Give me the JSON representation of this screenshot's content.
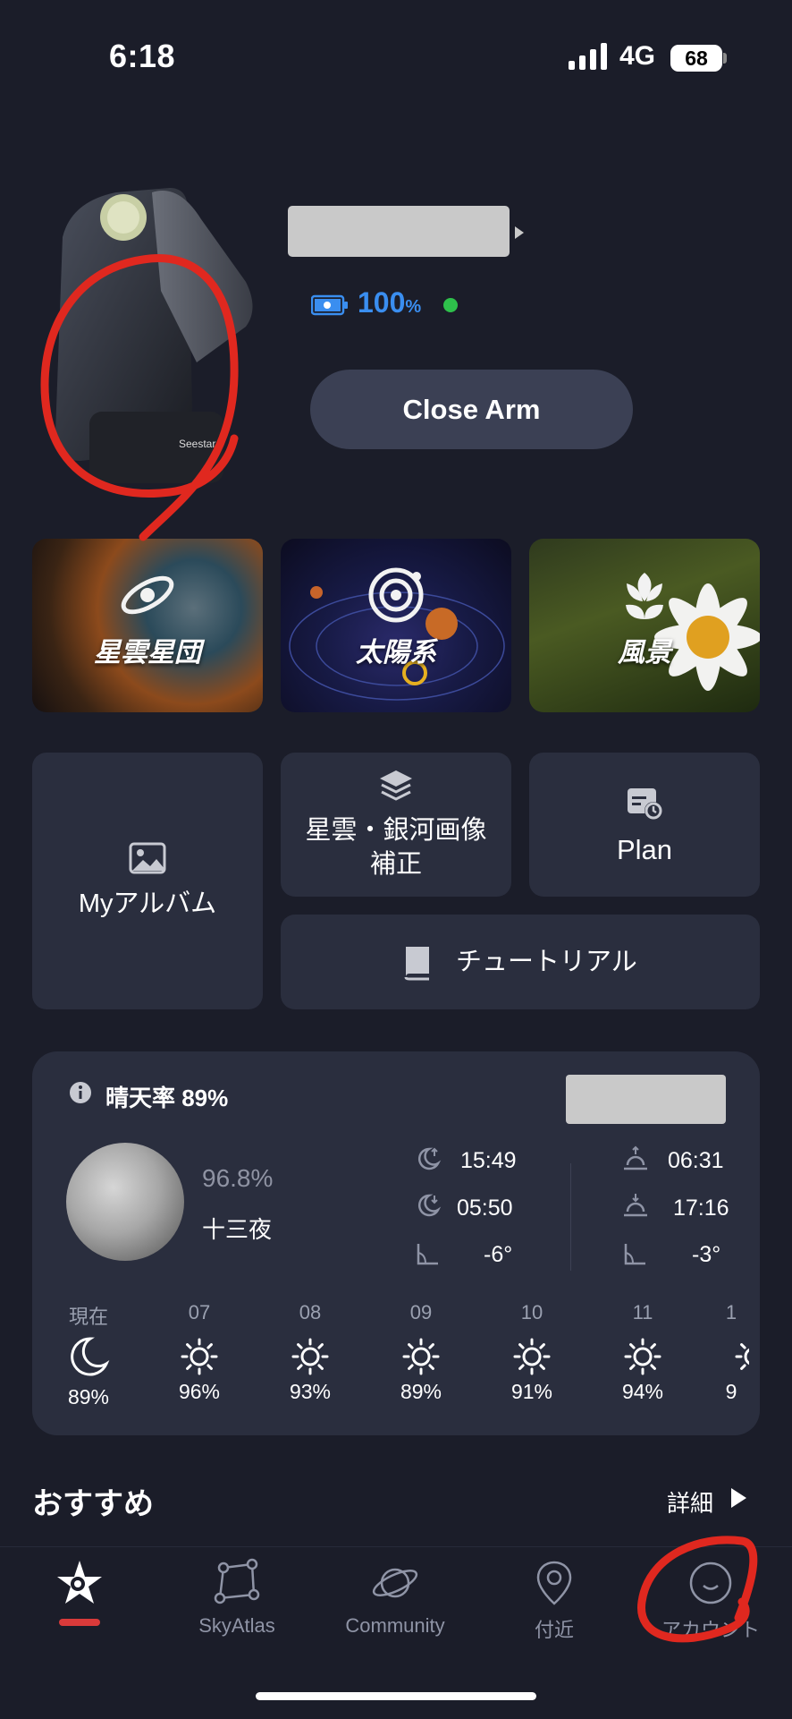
{
  "status_bar": {
    "time": "6:18",
    "network": "4G",
    "battery": "68"
  },
  "device": {
    "battery_pct": "100",
    "battery_unit": "%",
    "close_arm_label": "Close Arm",
    "logo_text": "Seestar"
  },
  "modes": [
    {
      "label": "星雲星団",
      "icon": "galaxy-icon"
    },
    {
      "label": "太陽系",
      "icon": "solar-system-icon"
    },
    {
      "label": "風景",
      "icon": "flower-icon"
    }
  ],
  "tiles": {
    "album": "Myアルバム",
    "correction_line1": "星雲・銀河画像",
    "correction_line2": "補正",
    "plan": "Plan",
    "tutorial": "チュートリアル"
  },
  "weather": {
    "clear_rate": "晴天率 89%",
    "moon_illum": "96.8%",
    "moon_phase": "十三夜",
    "moonrise": "15:49",
    "moonset": "05:50",
    "moon_alt": "-6°",
    "sunrise": "06:31",
    "sunset": "17:16",
    "sun_alt": "-3°",
    "hours": [
      {
        "label": "現在",
        "value": "89%",
        "icon": "moon-icon"
      },
      {
        "label": "07",
        "value": "96%",
        "icon": "sun-icon"
      },
      {
        "label": "08",
        "value": "93%",
        "icon": "sun-icon"
      },
      {
        "label": "09",
        "value": "89%",
        "icon": "sun-icon"
      },
      {
        "label": "10",
        "value": "91%",
        "icon": "sun-icon"
      },
      {
        "label": "11",
        "value": "94%",
        "icon": "sun-icon"
      },
      {
        "label": "1",
        "value": "9",
        "icon": "sun-icon"
      }
    ]
  },
  "recommendations": {
    "title": "おすすめ",
    "more": "詳細"
  },
  "tabs": [
    {
      "label": "",
      "icon": "seestar-star-icon",
      "active": true
    },
    {
      "label": "SkyAtlas",
      "icon": "constellation-icon"
    },
    {
      "label": "Community",
      "icon": "planet-icon"
    },
    {
      "label": "付近",
      "icon": "location-pin-icon"
    },
    {
      "label": "アカウント",
      "icon": "smiley-icon"
    }
  ],
  "colors": {
    "accent_blue": "#3a8ef0",
    "status_green": "#2ec04b",
    "active_tab_red": "#d93a3a",
    "annotation_red": "#e0281f"
  }
}
